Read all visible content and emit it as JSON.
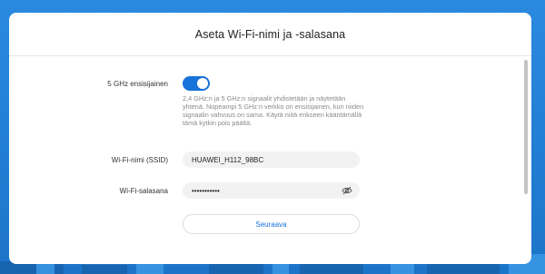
{
  "dialog": {
    "title": "Aseta Wi-Fi-nimi ja -salasana"
  },
  "band_priority": {
    "label": "5 GHz ensisijainen",
    "enabled": true,
    "hint": "2,4 GHz:n ja 5 GHz:n signaalit yhdistetään ja näytetään yhtenä. Nopeampi 5 GHz:n verkko on ensisijainen, kun niiden signaalin vahvuus on sama. Käytä niitä erikseen kääntämällä tämä kytkin pois päältä."
  },
  "ssid": {
    "label": "Wi-Fi-nimi (SSID)",
    "value": "HUAWEI_H112_98BC"
  },
  "password": {
    "label": "Wi-Fi-salasana",
    "value": "•••••••••••"
  },
  "next_button": {
    "label": "Seuraava"
  },
  "colors": {
    "accent": "#1772d9",
    "background": "#1f7ed3"
  }
}
